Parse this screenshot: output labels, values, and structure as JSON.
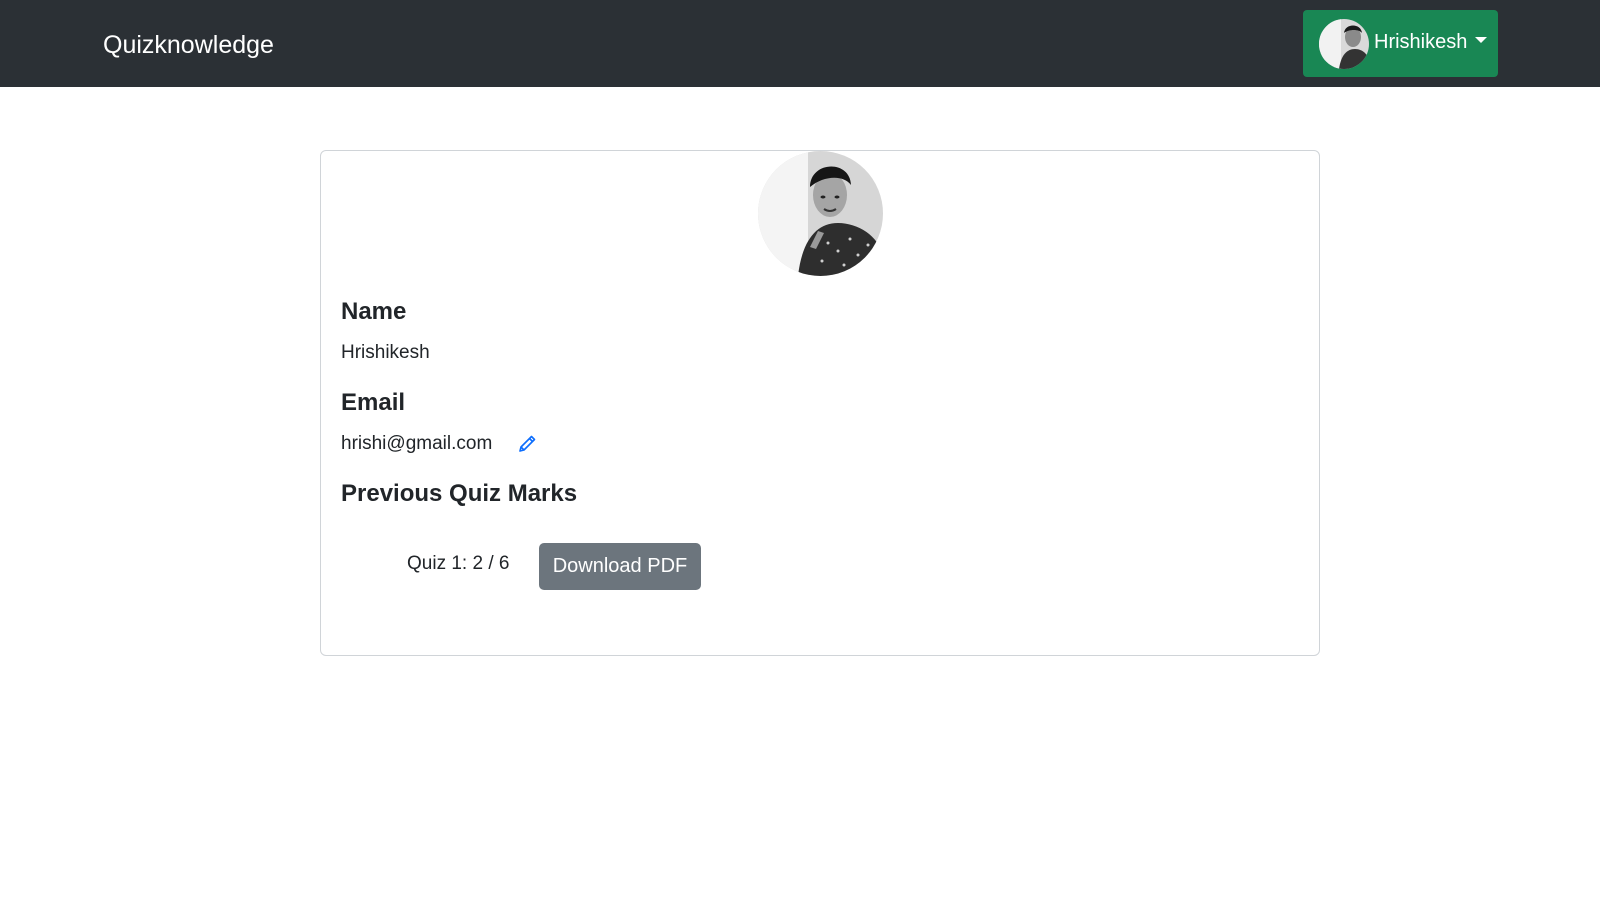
{
  "navbar": {
    "brand": "Quizknowledge",
    "user": {
      "name": "Hrishikesh"
    }
  },
  "profile": {
    "name_label": "Name",
    "name_value": "Hrishikesh",
    "email_label": "Email",
    "email_value": "hrishi@gmail.com",
    "marks_label": "Previous Quiz Marks",
    "quizzes": [
      {
        "text": "Quiz 1: 2 / 6",
        "button_label": "Download PDF"
      }
    ]
  },
  "colors": {
    "navbar_bg": "#2b3035",
    "user_button_bg": "#198754",
    "secondary_button_bg": "#6c757d",
    "edit_icon": "#0d6efd"
  },
  "icons": {
    "edit": "pencil-icon",
    "dropdown": "caret-down-icon"
  }
}
